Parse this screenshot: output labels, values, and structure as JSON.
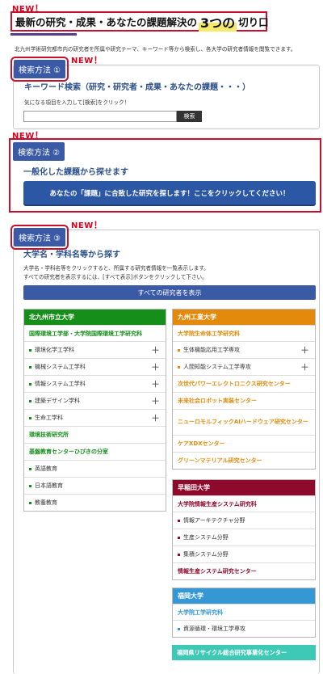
{
  "new_label": "NEW",
  "new_bang": "！",
  "header": {
    "title_prefix": "最新の研究・成果・あなたの課題解決の",
    "title_big": "3つの",
    "title_suffix": "切り口"
  },
  "intro_text": "北九州学術研究都市内の研究者を所属や研究テーマ、キーワード等から検索し、各大学の研究者情報を閲覧できます。",
  "method1": {
    "tag": "検索方法 ①",
    "heading": "キーワード検索（研究・研究者・成果・あなたの課題・・・）",
    "instruction": "気になる項目を入力して[検索]をクリック！",
    "input_value": "",
    "input_placeholder": "",
    "search_button": "検索"
  },
  "method2": {
    "tag": "検索方法 ②",
    "heading": "一般化した課題から探せます",
    "button": "あなたの「課題」に合致した研究を探します！ここをクリックしてください！"
  },
  "method3": {
    "tag": "検索方法 ③",
    "heading": "大学名・学科名等から探す",
    "desc1": "大学名・学科名等をクリックすると、所属する研究者情報を一覧表示します。",
    "desc2": "すべての研究者を表示するには、[すべて表示]ボタンをクリックして下さい。",
    "all_button": "すべての研究者を表示"
  },
  "universities": {
    "kitakyushu": {
      "name": "北九州市立大学",
      "color": "#168f1a",
      "rows": [
        {
          "label": "国際環境工学部・大学院国際環境工学研究科",
          "type": "bold"
        },
        {
          "label": "環境化学工学科",
          "type": "item",
          "plus": "＋"
        },
        {
          "label": "機械システム工学科",
          "type": "item",
          "plus": "＋"
        },
        {
          "label": "情報システム工学科",
          "type": "item",
          "plus": "＋"
        },
        {
          "label": "建築デザイン学科",
          "type": "item",
          "plus": "＋"
        },
        {
          "label": "生命工学科",
          "type": "item",
          "plus": "＋"
        },
        {
          "label": "環境技術研究所",
          "type": "bold"
        },
        {
          "label": "基盤教育センターひびきの分室",
          "type": "bold"
        },
        {
          "label": "英語教育",
          "type": "item"
        },
        {
          "label": "日本語教育",
          "type": "item"
        },
        {
          "label": "教養教育",
          "type": "item"
        }
      ]
    },
    "kyutech": {
      "name": "九州工業大学",
      "color": "#e38a0c",
      "rows": [
        {
          "label": "大学院生命体工学研究科",
          "type": "bold"
        },
        {
          "label": "生体機能応用工学専攻",
          "type": "item",
          "plus": "＋"
        },
        {
          "label": "人間知能システム工学専攻",
          "type": "item",
          "plus": "＋"
        },
        {
          "label": "次世代パワーエレクトロニクス研究センター",
          "type": "bold"
        },
        {
          "label": "未来社会ロボット実装センター",
          "type": "bold"
        },
        {
          "label": "ニューロモルフィックAIハードウェア研究センター",
          "type": "bold"
        },
        {
          "label": "ケアXDXセンター",
          "type": "bold"
        },
        {
          "label": "グリーンマテリアル研究センター",
          "type": "bold"
        }
      ]
    },
    "waseda": {
      "name": "早稲田大学",
      "color": "#8e0a2d",
      "rows": [
        {
          "label": "大学院情報生産システム研究科",
          "type": "bold"
        },
        {
          "label": "情報アーキテクチャ分野",
          "type": "item"
        },
        {
          "label": "生産システム分野",
          "type": "item"
        },
        {
          "label": "集積システム分野",
          "type": "item"
        },
        {
          "label": "情報生産システム研究センター",
          "type": "bold"
        }
      ]
    },
    "fukuoka": {
      "name": "福岡大学",
      "color": "#3597d3",
      "rows": [
        {
          "label": "大学院工学研究科",
          "type": "bold"
        },
        {
          "label": "資源循環・環境工学専攻",
          "type": "item"
        }
      ]
    },
    "recycle": {
      "name": "福岡県リサイクル総合研究事業化センター",
      "color": "#3ec9b6"
    }
  }
}
